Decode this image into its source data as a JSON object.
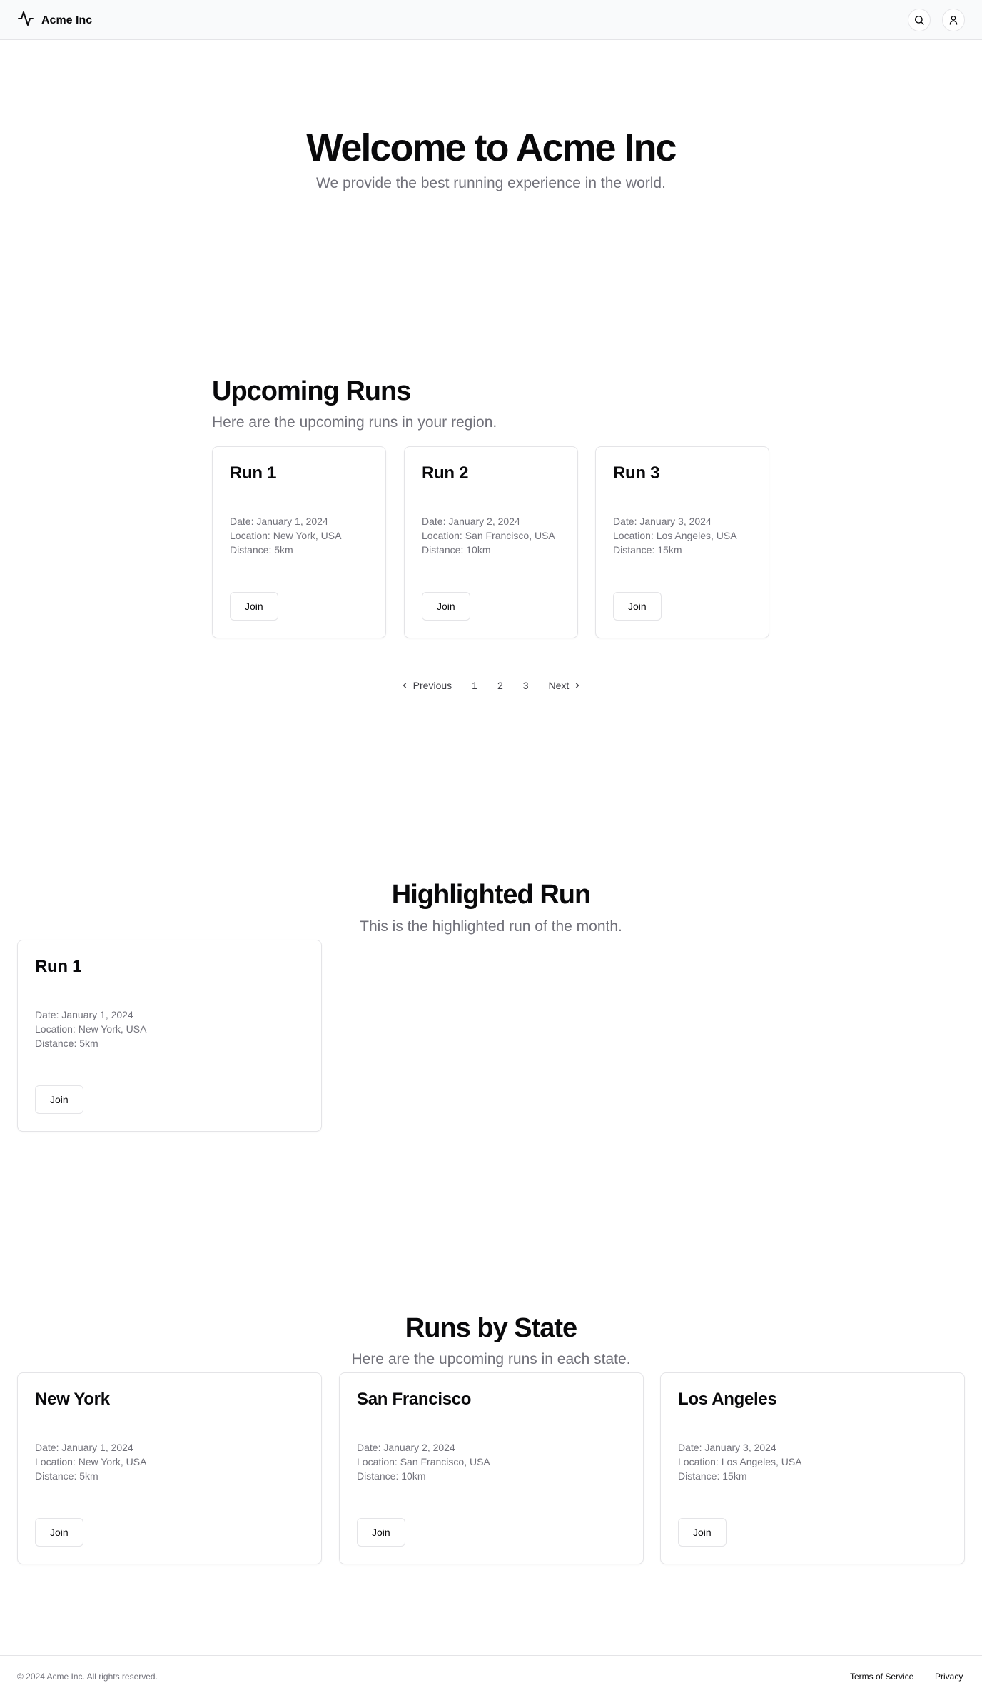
{
  "header": {
    "brand": "Acme Inc",
    "search_icon": "search-icon",
    "user_icon": "user-icon"
  },
  "hero": {
    "title": "Welcome to Acme Inc",
    "subtitle": "We provide the best running experience in the world."
  },
  "upcoming": {
    "title": "Upcoming Runs",
    "subtitle": "Here are the upcoming runs in your region.",
    "cards": [
      {
        "title": "Run 1",
        "date": "Date: January 1, 2024",
        "location": "Location: New York, USA",
        "distance": "Distance: 5km",
        "button": "Join"
      },
      {
        "title": "Run 2",
        "date": "Date: January 2, 2024",
        "location": "Location: San Francisco, USA",
        "distance": "Distance: 10km",
        "button": "Join"
      },
      {
        "title": "Run 3",
        "date": "Date: January 3, 2024",
        "location": "Location: Los Angeles, USA",
        "distance": "Distance: 15km",
        "button": "Join"
      }
    ],
    "pagination": {
      "previous": "Previous",
      "pages": [
        "1",
        "2",
        "3"
      ],
      "next": "Next"
    }
  },
  "highlighted": {
    "title": "Highlighted Run",
    "subtitle": "This is the highlighted run of the month.",
    "card": {
      "title": "Run 1",
      "date": "Date: January 1, 2024",
      "location": "Location: New York, USA",
      "distance": "Distance: 5km",
      "button": "Join"
    }
  },
  "by_state": {
    "title": "Runs by State",
    "subtitle": "Here are the upcoming runs in each state.",
    "cards": [
      {
        "title": "New York",
        "date": "Date: January 1, 2024",
        "location": "Location: New York, USA",
        "distance": "Distance: 5km",
        "button": "Join"
      },
      {
        "title": "San Francisco",
        "date": "Date: January 2, 2024",
        "location": "Location: San Francisco, USA",
        "distance": "Distance: 10km",
        "button": "Join"
      },
      {
        "title": "Los Angeles",
        "date": "Date: January 3, 2024",
        "location": "Location: Los Angeles, USA",
        "distance": "Distance: 15km",
        "button": "Join"
      }
    ]
  },
  "footer": {
    "copyright": "© 2024 Acme Inc. All rights reserved.",
    "links": [
      "Terms of Service",
      "Privacy"
    ]
  }
}
